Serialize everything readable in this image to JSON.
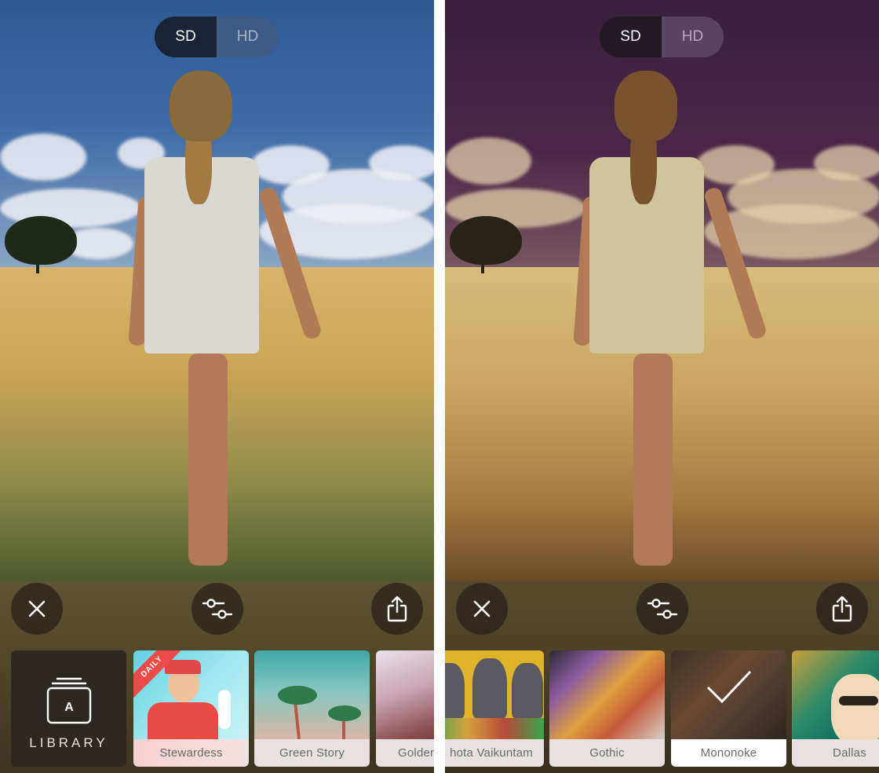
{
  "screens": [
    {
      "variant": "original",
      "quality_toggle": {
        "options": [
          "SD",
          "HD"
        ],
        "selected": "SD"
      },
      "toolbar": {
        "close_icon": "close-icon",
        "adjust_icon": "sliders-icon",
        "share_icon": "share-icon"
      },
      "library": {
        "label": "LIBRARY",
        "icon_glyph": "A"
      },
      "styles": [
        {
          "name": "Stewardess",
          "badge": "DAILY",
          "selected": false
        },
        {
          "name": "Green Story",
          "selected": false
        },
        {
          "name": "Golden",
          "selected": false
        }
      ]
    },
    {
      "variant": "stylized",
      "quality_toggle": {
        "options": [
          "SD",
          "HD"
        ],
        "selected": "SD"
      },
      "toolbar": {
        "close_icon": "close-icon",
        "adjust_icon": "sliders-icon",
        "share_icon": "share-icon"
      },
      "styles": [
        {
          "name": "Chhota Vaikuntam",
          "visible_text": "hota Vaikuntam",
          "selected": false
        },
        {
          "name": "Gothic",
          "selected": false
        },
        {
          "name": "Mononoke",
          "selected": true
        },
        {
          "name": "Dallas",
          "selected": false
        }
      ]
    }
  ],
  "colors": {
    "toolbar_bg": "#4f4629",
    "button_bg": "#282218",
    "daily_badge": "#ee4a4a",
    "label_bg": "#e7e1e1",
    "selected_label_bg": "#ffffff"
  }
}
